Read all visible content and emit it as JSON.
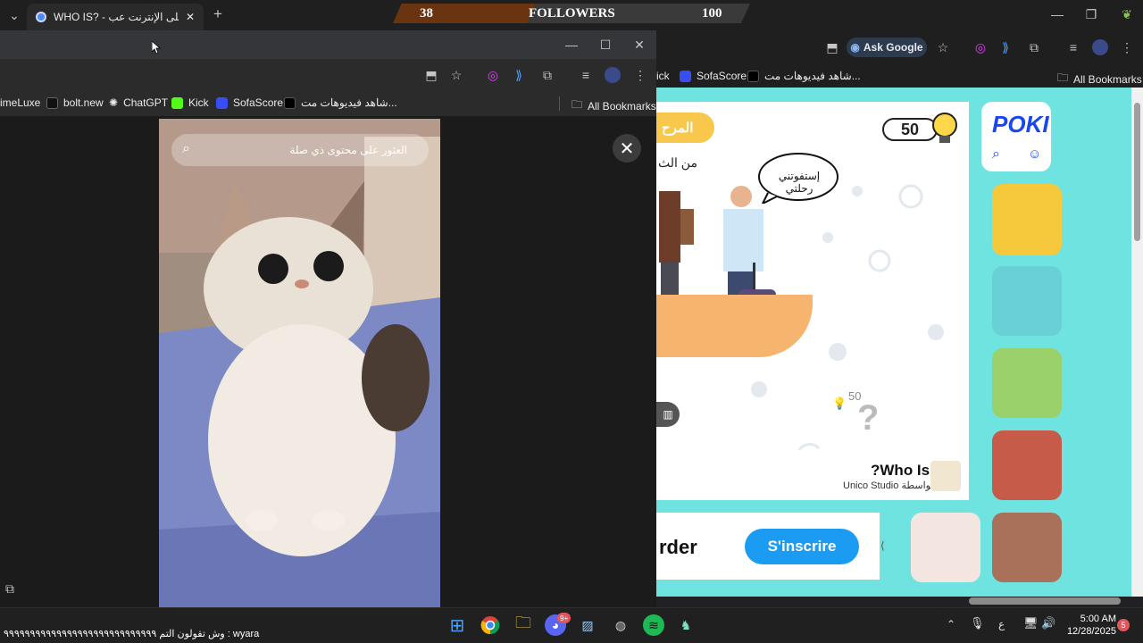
{
  "back_window": {
    "tab_title": "WHO IS? - مجانًا على الإنترنت عب",
    "ask_google": "Ask Google",
    "bookmarks": [
      "ick",
      "SofaScore",
      "شاهد فيديوهات مت...",
      "All Bookmarks"
    ]
  },
  "overlay": {
    "left_number": "38",
    "label": "FOLLOWERS",
    "right_number": "100"
  },
  "front_window": {
    "bookmarks": [
      "imeLuxe",
      "bolt.new",
      "ChatGPT",
      "Kick",
      "SofaScore",
      "شاهد فيديوهات مت...",
      "All Bookmarks"
    ],
    "search_placeholder": "العثور على محتوى ذي صلة"
  },
  "game": {
    "badge": "المرح",
    "partial_text": "من الث",
    "score": "50",
    "speech": "إستفوتني رحلتي",
    "hint_count": "50",
    "title": "?Who Is",
    "by": "Unico Studio بواسطة",
    "signup_text": "rder",
    "signup_button": "S'inscrire",
    "logo": "POKI"
  },
  "taskbar": {
    "ticker": "وش تقولون التم ٩٩٩٩٩٩٩٩٩٩٩٩٩٩٩٩٩٩٩٩٩٩٩٩٩٩٩٩٩ : wyara",
    "lang": "ع",
    "time": "5:00 AM",
    "date": "12/28/2025",
    "notifications": "5",
    "discord_badge": "9+"
  },
  "colors": {
    "poki_bg": "#6ee3df",
    "signup_blue": "#1b9cf2",
    "poki_logo_blue": "#1a46f0",
    "badge_yellow": "#f7c84b"
  }
}
